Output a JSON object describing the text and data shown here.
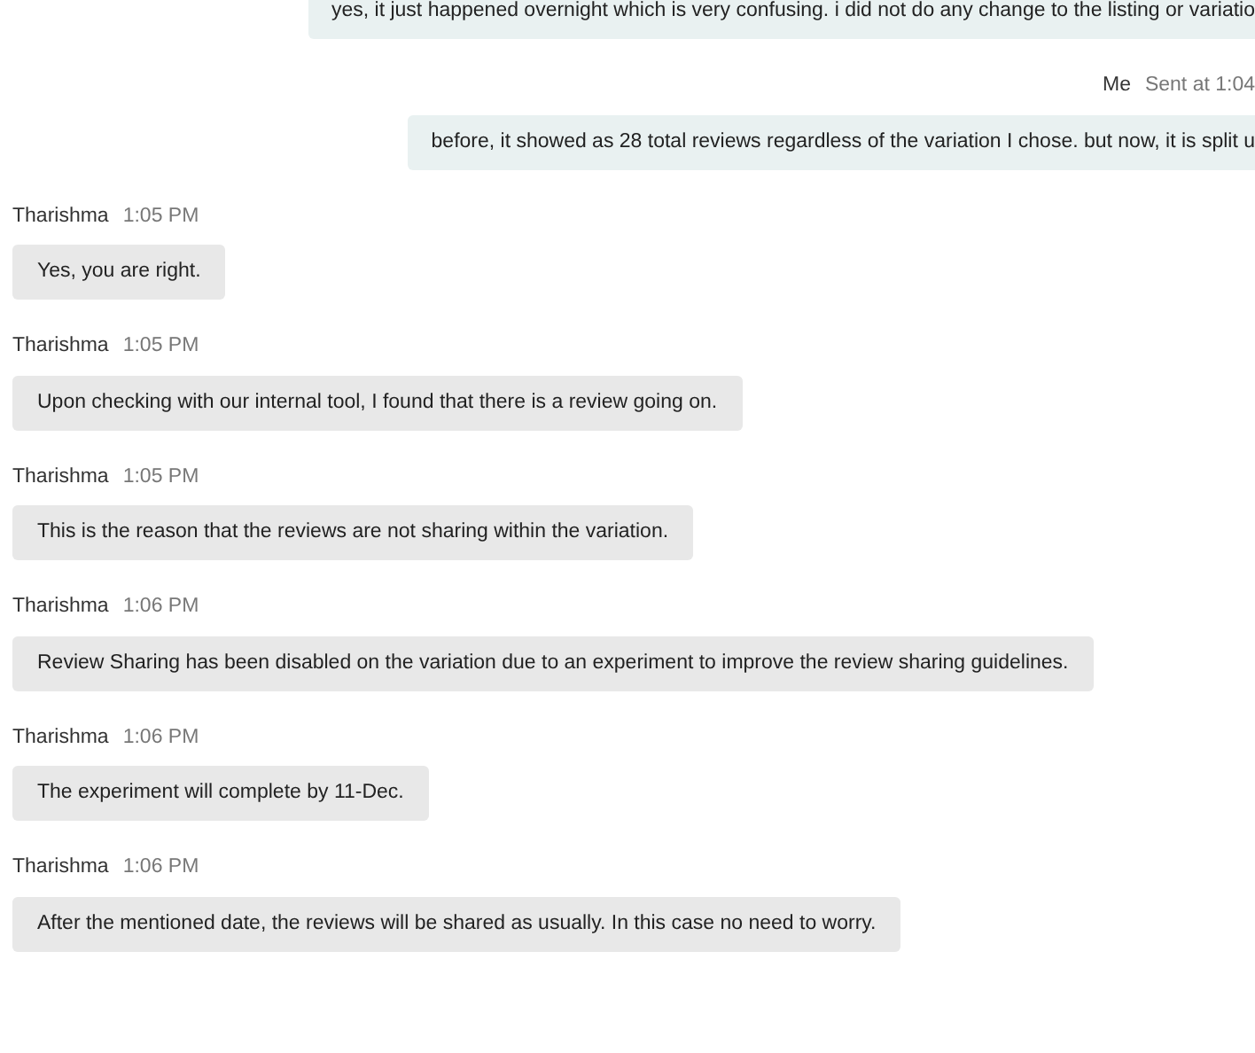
{
  "messages": [
    {
      "kind": "me",
      "text": "yes, it just happened overnight which is very confusing. i did not do any change to the listing or variatio"
    },
    {
      "kind": "me",
      "sender": "Me",
      "time": "Sent at 1:04",
      "text": "before, it showed as 28 total reviews regardless of the variation I chose. but now, it is split u"
    },
    {
      "kind": "agent",
      "sender": "Tharishma",
      "time": "1:05 PM",
      "text": "Yes, you are right."
    },
    {
      "kind": "agent",
      "sender": "Tharishma",
      "time": "1:05 PM",
      "text": "Upon checking with our internal tool, I found that there is a review going on."
    },
    {
      "kind": "agent",
      "sender": "Tharishma",
      "time": "1:05 PM",
      "text": "This is the reason that the reviews are not sharing within the variation."
    },
    {
      "kind": "agent",
      "sender": "Tharishma",
      "time": "1:06 PM",
      "text": "Review Sharing has been disabled on the variation due to an experiment to improve the review sharing guidelines."
    },
    {
      "kind": "agent",
      "sender": "Tharishma",
      "time": "1:06 PM",
      "text": "The experiment will complete by 11-Dec."
    },
    {
      "kind": "agent",
      "sender": "Tharishma",
      "time": "1:06 PM",
      "text": "After the mentioned date, the reviews will be shared as usually. In this case no need to worry."
    }
  ]
}
